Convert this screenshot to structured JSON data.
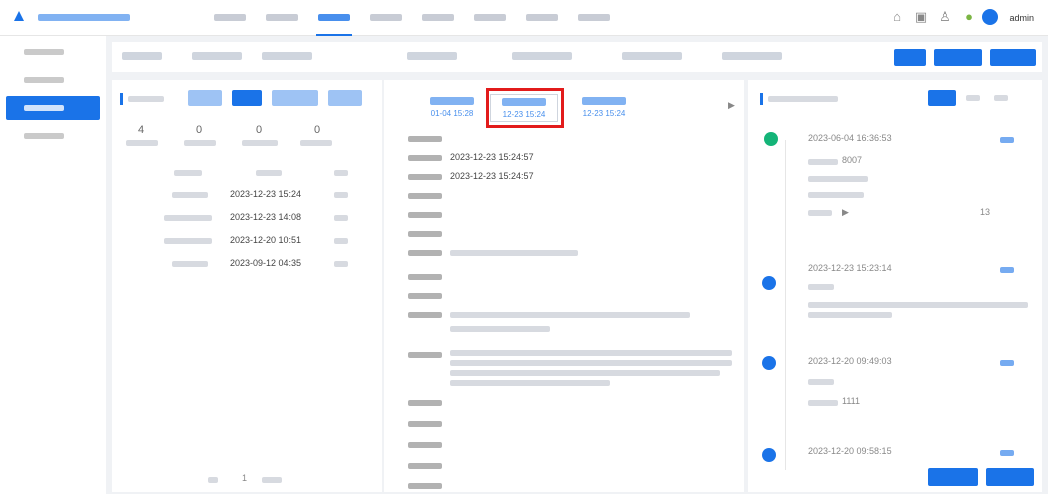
{
  "colors": {
    "accent": "#1a73e8",
    "highlight": "#e21b1b",
    "phone_icon": "#14b478"
  },
  "header": {
    "user": "admin"
  },
  "stats": [
    "4",
    "0",
    "0",
    "0"
  ],
  "event_rows": [
    {
      "date": "2023-12-23 15:24"
    },
    {
      "date": "2023-12-23 14:08"
    },
    {
      "date": "2023-12-20 10:51"
    },
    {
      "date": "2023-09-12 04:35"
    }
  ],
  "tabs": [
    {
      "date": "01-04 15:28"
    },
    {
      "date": "12-23 15:24"
    },
    {
      "date": "12-23 15:24"
    }
  ],
  "detail": {
    "value_2": "2023-12-23 15:24:57",
    "value_3": "2023-12-23 15:24:57"
  },
  "timeline": [
    {
      "date": "2023-06-04 16:36:53",
      "number": "8007",
      "extra": "13"
    },
    {
      "date": "2023-12-23 15:23:14",
      "number": ""
    },
    {
      "date": "2023-12-20 09:49:03",
      "number": "1111"
    },
    {
      "date": "2023-12-20 09:58:15",
      "number": ""
    }
  ],
  "pager": {
    "page": "1"
  }
}
